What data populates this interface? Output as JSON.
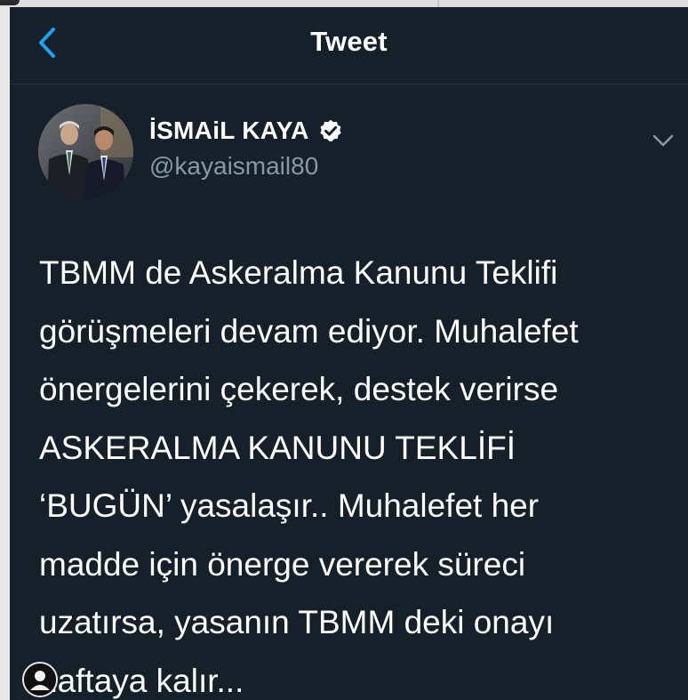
{
  "header": {
    "title": "Tweet",
    "back_icon": "chevron-left-icon"
  },
  "author": {
    "display_name": "İSMAiL KAYA",
    "handle": "@kayaismail80",
    "verified_icon": "verified-badge-icon",
    "menu_icon": "chevron-down-icon"
  },
  "tweet": {
    "lines": [
      "TBMM de Askeralma Kanunu Teklifi",
      "görüşmeleri devam ediyor. Muhalefet",
      "önergelerini çekerek, destek verirse",
      "ASKERALMA KANUNU TEKLİFİ",
      "‘BUGÜN’ yasalaşır.. Muhalefet her",
      "madde için önerge vererek süreci",
      "uzatırsa, yasanın TBMM deki onayı",
      "haftaya kalır..."
    ]
  },
  "colors": {
    "background": "#15202b",
    "accent": "#1da1f2",
    "text_primary": "#ffffff",
    "text_secondary": "#8899a6",
    "divider": "#243447"
  }
}
